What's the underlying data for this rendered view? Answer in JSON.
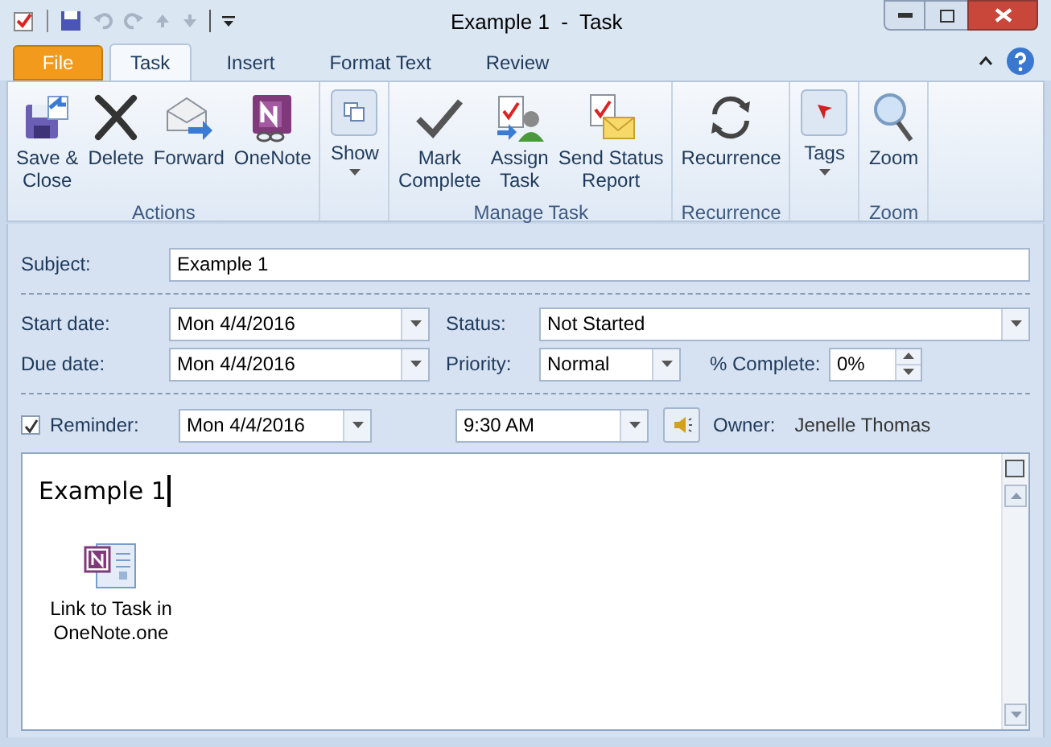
{
  "window": {
    "title": "Example 1  -  Task"
  },
  "tabs": [
    {
      "label": "File",
      "kind": "file",
      "selected": false
    },
    {
      "label": "Task",
      "kind": "tab",
      "selected": true
    },
    {
      "label": "Insert",
      "kind": "tab",
      "selected": false
    },
    {
      "label": "Format Text",
      "kind": "tab",
      "selected": false
    },
    {
      "label": "Review",
      "kind": "tab",
      "selected": false
    }
  ],
  "ribbon": {
    "groups": [
      {
        "label": "Actions",
        "buttons": [
          {
            "lines": [
              "Save &",
              "Close"
            ],
            "kind": "large"
          },
          {
            "lines": [
              "Delete"
            ],
            "kind": "large"
          },
          {
            "lines": [
              "Forward"
            ],
            "kind": "large"
          },
          {
            "lines": [
              "OneNote"
            ],
            "kind": "large"
          }
        ]
      },
      {
        "buttons": [
          {
            "lines": [
              "Show"
            ],
            "kind": "dropdown"
          }
        ]
      },
      {
        "label": "Manage Task",
        "buttons": [
          {
            "lines": [
              "Mark",
              "Complete"
            ],
            "kind": "large"
          },
          {
            "lines": [
              "Assign",
              "Task"
            ],
            "kind": "large"
          },
          {
            "lines": [
              "Send Status",
              "Report"
            ],
            "kind": "large"
          }
        ]
      },
      {
        "label": "Recurrence",
        "buttons": [
          {
            "lines": [
              "Recurrence"
            ],
            "kind": "large"
          }
        ]
      },
      {
        "buttons": [
          {
            "lines": [
              "Tags"
            ],
            "kind": "dropdown"
          }
        ]
      },
      {
        "label": "Zoom",
        "buttons": [
          {
            "lines": [
              "Zoom"
            ],
            "kind": "large"
          }
        ]
      }
    ]
  },
  "form": {
    "subject": {
      "label": "Subject:",
      "value": "Example 1"
    },
    "start_date": {
      "label": "Start date:",
      "value": "Mon 4/4/2016"
    },
    "status": {
      "label": "Status:",
      "value": "Not Started"
    },
    "due_date": {
      "label": "Due date:",
      "value": "Mon 4/4/2016"
    },
    "priority": {
      "label": "Priority:",
      "value": "Normal"
    },
    "percent_complete": {
      "label": "% Complete:",
      "value": "0%"
    },
    "reminder": {
      "label": "Reminder:",
      "checked": true,
      "date": "Mon 4/4/2016",
      "time": "9:30 AM"
    },
    "owner": {
      "label": "Owner:",
      "value": "Jenelle Thomas"
    }
  },
  "body": {
    "text": "Example 1",
    "attachment": {
      "label": "Link to Task in OneNote.one"
    }
  }
}
